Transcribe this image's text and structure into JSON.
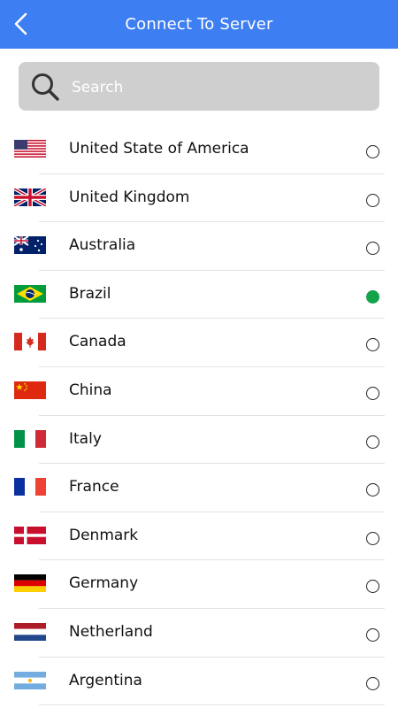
{
  "header": {
    "title": "Connect To Server",
    "back_icon": "back-arrow-icon"
  },
  "search": {
    "placeholder": "Search",
    "icon": "search-icon"
  },
  "colors": {
    "accent": "#3d7ef2",
    "selected": "#14a34a"
  },
  "countries": [
    {
      "id": "usa",
      "label": "United State of America",
      "flag": "usa",
      "selected": false
    },
    {
      "id": "uk",
      "label": "United Kingdom",
      "flag": "uk",
      "selected": false
    },
    {
      "id": "australia",
      "label": "Australia",
      "flag": "australia",
      "selected": false
    },
    {
      "id": "brazil",
      "label": "Brazil",
      "flag": "brazil",
      "selected": true
    },
    {
      "id": "canada",
      "label": "Canada",
      "flag": "canada",
      "selected": false
    },
    {
      "id": "china",
      "label": "China",
      "flag": "china",
      "selected": false
    },
    {
      "id": "italy",
      "label": "Italy",
      "flag": "italy",
      "selected": false
    },
    {
      "id": "france",
      "label": "France",
      "flag": "france",
      "selected": false
    },
    {
      "id": "denmark",
      "label": "Denmark",
      "flag": "denmark",
      "selected": false
    },
    {
      "id": "germany",
      "label": "Germany",
      "flag": "germany",
      "selected": false
    },
    {
      "id": "netherland",
      "label": "Netherland",
      "flag": "netherlands",
      "selected": false
    },
    {
      "id": "argentina",
      "label": "Argentina",
      "flag": "argentina",
      "selected": false
    }
  ]
}
